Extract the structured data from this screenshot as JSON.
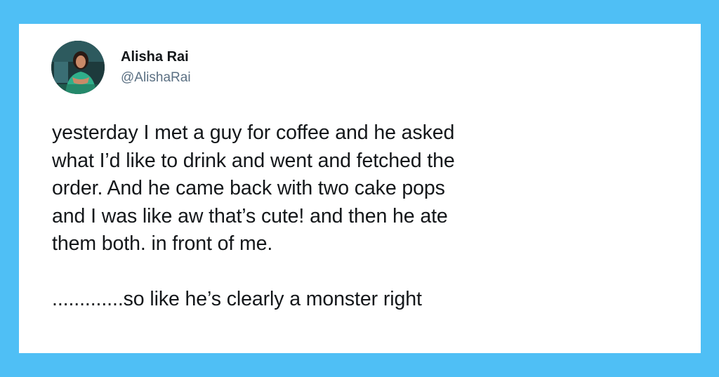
{
  "theme": {
    "background": "#4fbff5",
    "card": "#ffffff",
    "text": "#14171a",
    "handle_color": "#5b7083"
  },
  "author": {
    "name": "Alisha Rai",
    "handle": "@AlishaRai",
    "avatar_icon": "profile-photo"
  },
  "tweet": {
    "lines": [
      "yesterday I met a guy for coffee and he asked",
      "what I’d like to drink and went and fetched the",
      "order. And he came back with two cake pops",
      "and I was like aw that’s cute! and then he ate",
      "them both. in front of me."
    ],
    "closing": ".............so like he’s clearly a monster right"
  }
}
